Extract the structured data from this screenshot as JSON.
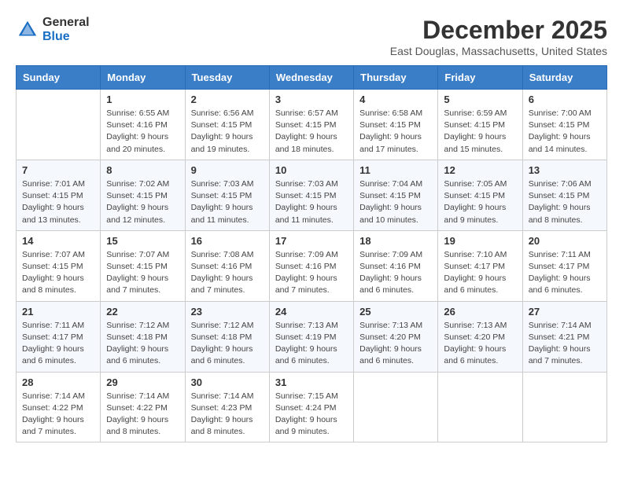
{
  "header": {
    "logo_general": "General",
    "logo_blue": "Blue",
    "month_title": "December 2025",
    "location": "East Douglas, Massachusetts, United States"
  },
  "days_of_week": [
    "Sunday",
    "Monday",
    "Tuesday",
    "Wednesday",
    "Thursday",
    "Friday",
    "Saturday"
  ],
  "weeks": [
    [
      {
        "day": "",
        "info": ""
      },
      {
        "day": "1",
        "info": "Sunrise: 6:55 AM\nSunset: 4:16 PM\nDaylight: 9 hours\nand 20 minutes."
      },
      {
        "day": "2",
        "info": "Sunrise: 6:56 AM\nSunset: 4:15 PM\nDaylight: 9 hours\nand 19 minutes."
      },
      {
        "day": "3",
        "info": "Sunrise: 6:57 AM\nSunset: 4:15 PM\nDaylight: 9 hours\nand 18 minutes."
      },
      {
        "day": "4",
        "info": "Sunrise: 6:58 AM\nSunset: 4:15 PM\nDaylight: 9 hours\nand 17 minutes."
      },
      {
        "day": "5",
        "info": "Sunrise: 6:59 AM\nSunset: 4:15 PM\nDaylight: 9 hours\nand 15 minutes."
      },
      {
        "day": "6",
        "info": "Sunrise: 7:00 AM\nSunset: 4:15 PM\nDaylight: 9 hours\nand 14 minutes."
      }
    ],
    [
      {
        "day": "7",
        "info": "Sunrise: 7:01 AM\nSunset: 4:15 PM\nDaylight: 9 hours\nand 13 minutes."
      },
      {
        "day": "8",
        "info": "Sunrise: 7:02 AM\nSunset: 4:15 PM\nDaylight: 9 hours\nand 12 minutes."
      },
      {
        "day": "9",
        "info": "Sunrise: 7:03 AM\nSunset: 4:15 PM\nDaylight: 9 hours\nand 11 minutes."
      },
      {
        "day": "10",
        "info": "Sunrise: 7:03 AM\nSunset: 4:15 PM\nDaylight: 9 hours\nand 11 minutes."
      },
      {
        "day": "11",
        "info": "Sunrise: 7:04 AM\nSunset: 4:15 PM\nDaylight: 9 hours\nand 10 minutes."
      },
      {
        "day": "12",
        "info": "Sunrise: 7:05 AM\nSunset: 4:15 PM\nDaylight: 9 hours\nand 9 minutes."
      },
      {
        "day": "13",
        "info": "Sunrise: 7:06 AM\nSunset: 4:15 PM\nDaylight: 9 hours\nand 8 minutes."
      }
    ],
    [
      {
        "day": "14",
        "info": "Sunrise: 7:07 AM\nSunset: 4:15 PM\nDaylight: 9 hours\nand 8 minutes."
      },
      {
        "day": "15",
        "info": "Sunrise: 7:07 AM\nSunset: 4:15 PM\nDaylight: 9 hours\nand 7 minutes."
      },
      {
        "day": "16",
        "info": "Sunrise: 7:08 AM\nSunset: 4:16 PM\nDaylight: 9 hours\nand 7 minutes."
      },
      {
        "day": "17",
        "info": "Sunrise: 7:09 AM\nSunset: 4:16 PM\nDaylight: 9 hours\nand 7 minutes."
      },
      {
        "day": "18",
        "info": "Sunrise: 7:09 AM\nSunset: 4:16 PM\nDaylight: 9 hours\nand 6 minutes."
      },
      {
        "day": "19",
        "info": "Sunrise: 7:10 AM\nSunset: 4:17 PM\nDaylight: 9 hours\nand 6 minutes."
      },
      {
        "day": "20",
        "info": "Sunrise: 7:11 AM\nSunset: 4:17 PM\nDaylight: 9 hours\nand 6 minutes."
      }
    ],
    [
      {
        "day": "21",
        "info": "Sunrise: 7:11 AM\nSunset: 4:17 PM\nDaylight: 9 hours\nand 6 minutes."
      },
      {
        "day": "22",
        "info": "Sunrise: 7:12 AM\nSunset: 4:18 PM\nDaylight: 9 hours\nand 6 minutes."
      },
      {
        "day": "23",
        "info": "Sunrise: 7:12 AM\nSunset: 4:18 PM\nDaylight: 9 hours\nand 6 minutes."
      },
      {
        "day": "24",
        "info": "Sunrise: 7:13 AM\nSunset: 4:19 PM\nDaylight: 9 hours\nand 6 minutes."
      },
      {
        "day": "25",
        "info": "Sunrise: 7:13 AM\nSunset: 4:20 PM\nDaylight: 9 hours\nand 6 minutes."
      },
      {
        "day": "26",
        "info": "Sunrise: 7:13 AM\nSunset: 4:20 PM\nDaylight: 9 hours\nand 6 minutes."
      },
      {
        "day": "27",
        "info": "Sunrise: 7:14 AM\nSunset: 4:21 PM\nDaylight: 9 hours\nand 7 minutes."
      }
    ],
    [
      {
        "day": "28",
        "info": "Sunrise: 7:14 AM\nSunset: 4:22 PM\nDaylight: 9 hours\nand 7 minutes."
      },
      {
        "day": "29",
        "info": "Sunrise: 7:14 AM\nSunset: 4:22 PM\nDaylight: 9 hours\nand 8 minutes."
      },
      {
        "day": "30",
        "info": "Sunrise: 7:14 AM\nSunset: 4:23 PM\nDaylight: 9 hours\nand 8 minutes."
      },
      {
        "day": "31",
        "info": "Sunrise: 7:15 AM\nSunset: 4:24 PM\nDaylight: 9 hours\nand 9 minutes."
      },
      {
        "day": "",
        "info": ""
      },
      {
        "day": "",
        "info": ""
      },
      {
        "day": "",
        "info": ""
      }
    ]
  ]
}
